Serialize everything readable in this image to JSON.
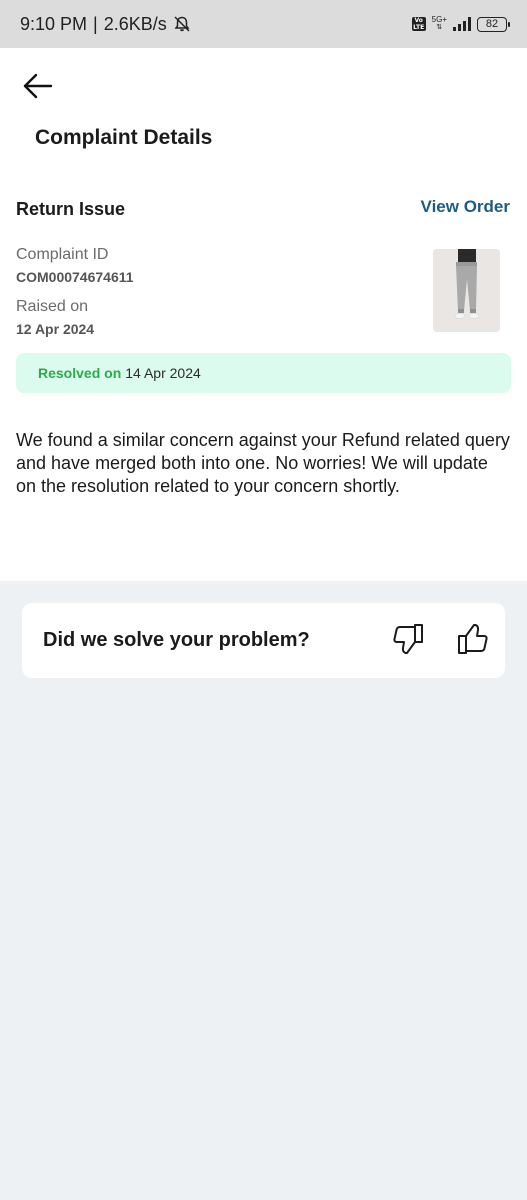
{
  "status_bar": {
    "time": "9:10 PM",
    "separator": "|",
    "speed": "2.6KB/s",
    "network": "5G+",
    "volte": "Vo LTE",
    "battery": "82",
    "icons": [
      "mute-bell-icon",
      "volte-icon",
      "signal-icon",
      "battery-icon"
    ]
  },
  "header": {
    "back_icon": "arrow-left-icon",
    "title": "Complaint Details"
  },
  "complaint": {
    "issue_title": "Return Issue",
    "view_order_label": "View Order",
    "id_label": "Complaint ID",
    "id_value": "COM00074674611",
    "raised_label": "Raised on",
    "raised_value": "12 Apr 2024",
    "resolved_label": "Resolved on",
    "resolved_date": "14 Apr 2024",
    "message": "We found a similar concern against your Refund related query and have merged both into one. No worries! We will update on the resolution related to your concern shortly."
  },
  "feedback": {
    "question": "Did we solve your problem?",
    "icons": [
      "thumbs-down-icon",
      "thumbs-up-icon"
    ]
  },
  "colors": {
    "accent": "#1e5b86",
    "resolved_bg": "#dcfbef",
    "resolved_text": "#2eaa4a",
    "page_bg": "#eef1f4"
  }
}
